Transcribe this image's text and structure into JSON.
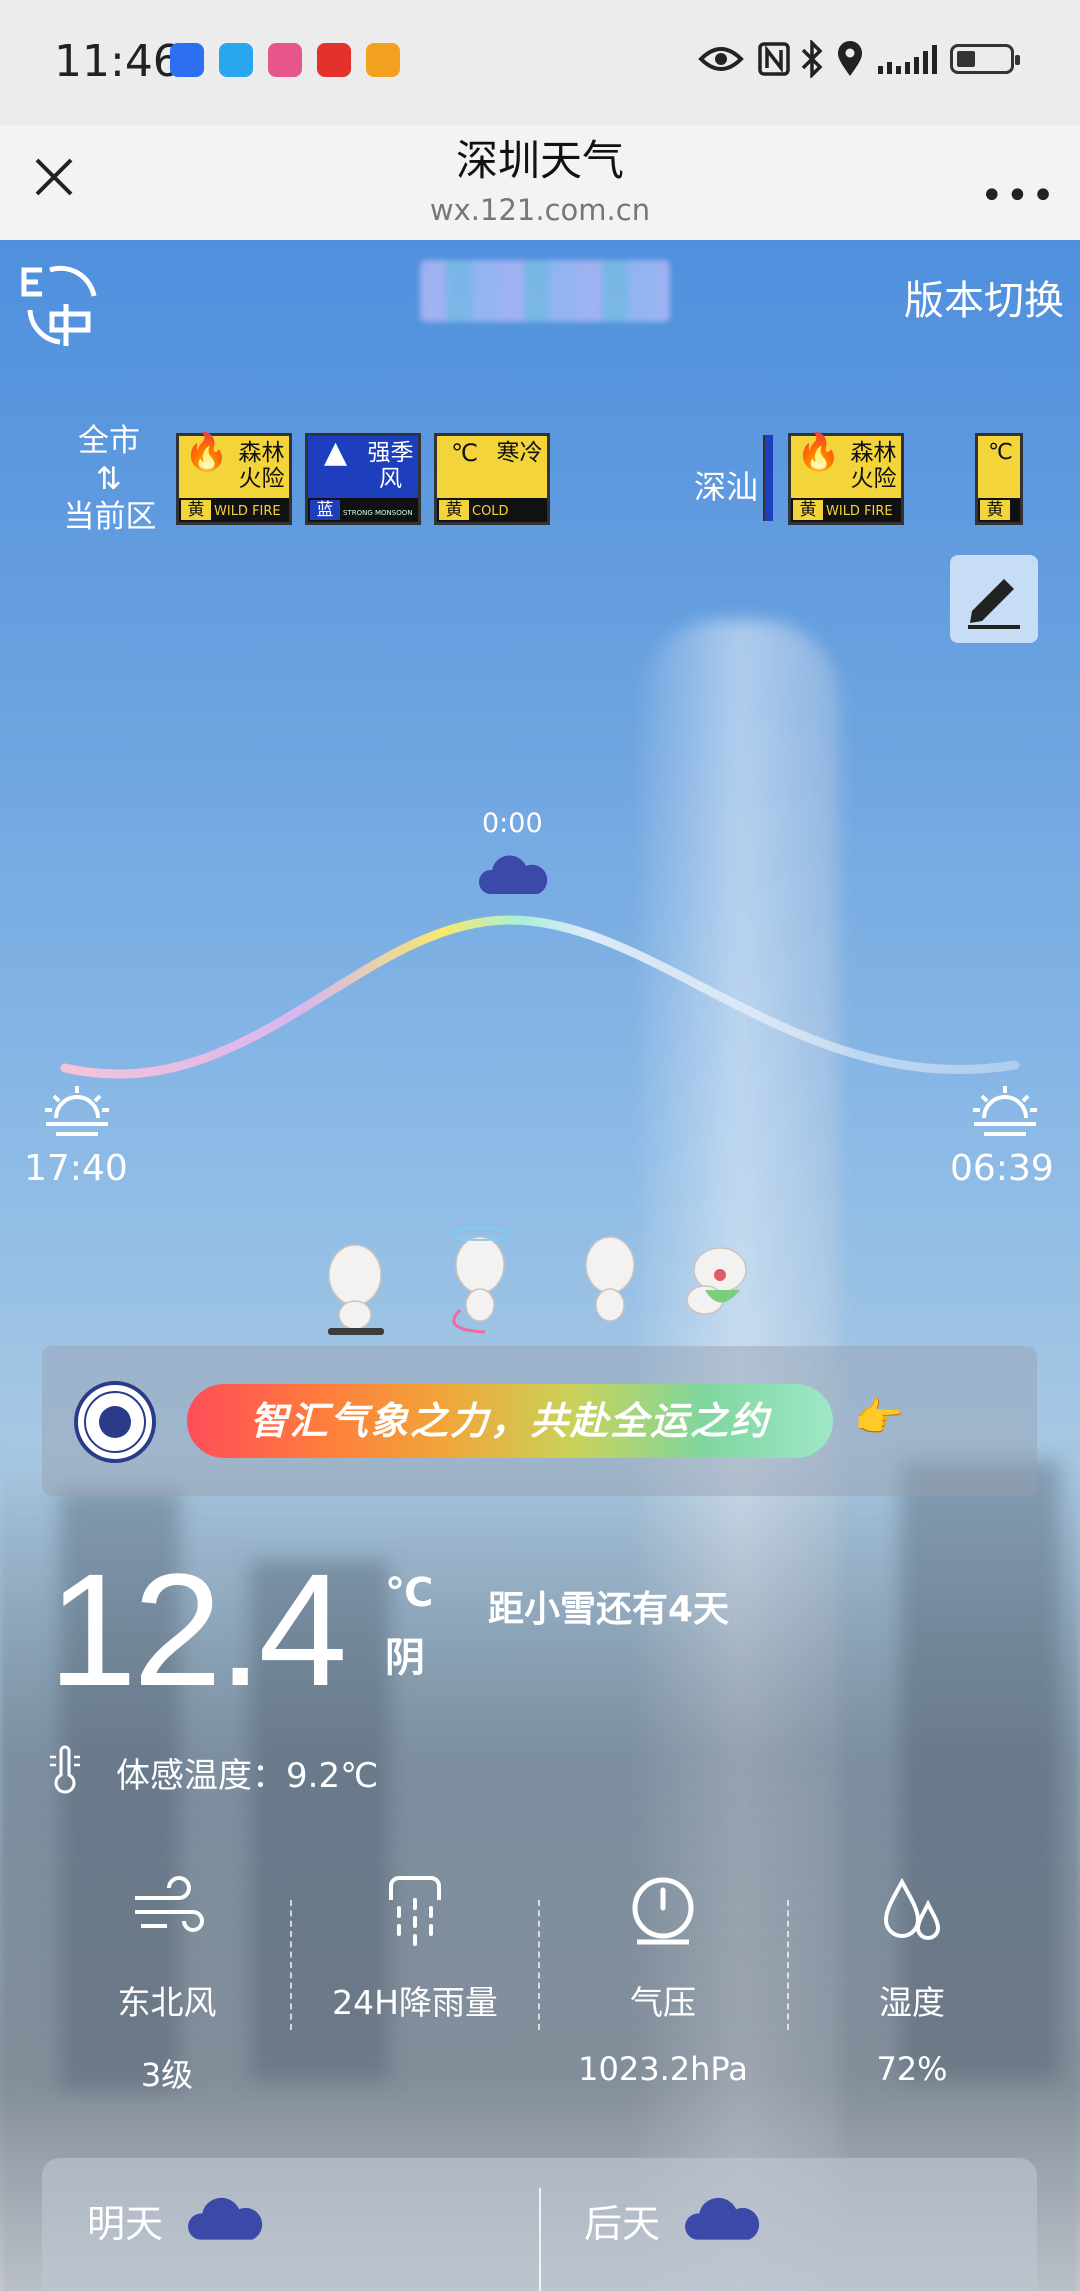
{
  "status_bar": {
    "time": "11:46",
    "app_icons": [
      {
        "name": "voice-app-icon",
        "color": "#2e6ff2"
      },
      {
        "name": "chat-app-icon",
        "color": "#2aa6f0"
      },
      {
        "name": "bilibili-app-icon",
        "color": "#e7568a"
      },
      {
        "name": "video-app-icon",
        "color": "#e4312b"
      },
      {
        "name": "notes-app-icon",
        "color": "#f3a21f"
      }
    ],
    "system_icons": [
      "eye-icon",
      "nfc-icon",
      "bluetooth-icon",
      "location-icon",
      "signal-icon",
      "battery-icon"
    ]
  },
  "browser": {
    "title": "深圳天气",
    "url": "wx.121.com.cn"
  },
  "header": {
    "language_icon": "language-switch-icon",
    "language_icon_text": "E 中",
    "version_switch": "版本切换"
  },
  "alerts": {
    "city_switch_top": "全市",
    "city_switch_arrows": "⇅",
    "city_switch_bottom": "当前区",
    "shenshan_label": "深汕",
    "items": [
      {
        "top_left": "🔥",
        "top_right": "森林火险",
        "level": "黄",
        "en": "WILD FIRE"
      },
      {
        "top_left": "▲",
        "top_right": "强季风",
        "level": "蓝",
        "en": "STRONG MONSOON"
      },
      {
        "top_left": "℃",
        "top_right": "寒冷",
        "level": "黄",
        "en": "COLD"
      },
      {
        "top_left": "🔥",
        "top_right": "森林火险",
        "level": "黄",
        "en": "WILD FIRE"
      },
      {
        "top_left": "℃",
        "top_right": "",
        "level": "黄",
        "en": ""
      }
    ]
  },
  "sun_curve": {
    "current_time": "0:00",
    "sunset_time": "17:40",
    "sunrise_time": "06:39"
  },
  "banner": {
    "text": "智汇气象之力，共赴全运之约",
    "pointer": "👉"
  },
  "current": {
    "temperature": "12.4",
    "unit": "℃",
    "condition": "阴",
    "solar_term": "距小雪还有4天",
    "feels_like": "体感温度：9.2℃"
  },
  "stats": [
    {
      "label": "东北风",
      "value": "3级",
      "icon": "wind-icon"
    },
    {
      "label": "24H降雨量",
      "value": "",
      "icon": "rain-icon"
    },
    {
      "label": "气压",
      "value": "1023.2hPa",
      "icon": "pressure-gauge-icon"
    },
    {
      "label": "湿度",
      "value": "72%",
      "icon": "humidity-icon"
    }
  ],
  "forecast": {
    "tomorrow": "明天",
    "day_after": "后天"
  }
}
